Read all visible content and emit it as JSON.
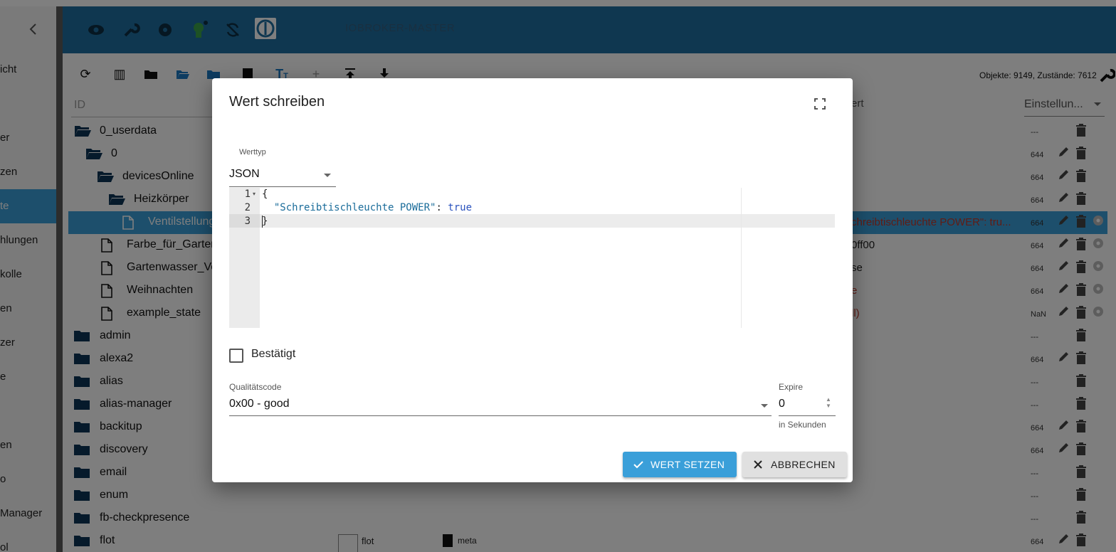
{
  "sidebar": {
    "collapse_icon": "chevron-left-icon",
    "items": [
      {
        "label": "icht",
        "active": false
      },
      {
        "label": "er",
        "active": false
      },
      {
        "label": "zen",
        "active": false
      },
      {
        "label": "te",
        "active": true
      },
      {
        "label": "hlungen",
        "active": false
      },
      {
        "label": "kolle",
        "active": false
      },
      {
        "label": "en",
        "active": false
      },
      {
        "label": "zer",
        "active": false
      },
      {
        "label": "e",
        "active": false
      },
      {
        "label": "en",
        "active": false
      },
      {
        "label": "o",
        "active": false
      },
      {
        "label": "Manager",
        "active": false
      },
      {
        "label": "ol",
        "active": false
      }
    ]
  },
  "header": {
    "icons": [
      "eye-icon",
      "wrench-icon",
      "settings-icon",
      "person-icon",
      "sync-off-icon",
      "iobroker-logo-icon"
    ],
    "host_name": "IOBROKER-MASTER"
  },
  "toolbar": {
    "icons": [
      "refresh-icon",
      "columns-icon",
      "folder-icon",
      "folder-open-icon",
      "folder-blue-icon",
      "document-icon",
      "text-format-icon",
      "add-icon",
      "upload-icon",
      "download-icon"
    ],
    "stats": "Objekte: 9149, Zustände: 7612",
    "settings_icon": "wrench-icon"
  },
  "table": {
    "col_id": "ID",
    "col_value_partial": "ert",
    "settings_select": "Einstellun...",
    "rows": [
      {
        "label": "0_userdata",
        "icon": "folder-open-icon",
        "perm": "---"
      },
      {
        "label": "0",
        "icon": "folder-open-icon",
        "perm": "644"
      },
      {
        "label": "devicesOnline",
        "icon": "folder-open-icon",
        "perm": "664"
      },
      {
        "label": "Heizkörper",
        "icon": "folder-open-icon",
        "perm": "664"
      },
      {
        "label": "Ventilstellung",
        "icon": "file-icon",
        "perm": "664",
        "value": "chreibtischleuchte POWER\": tru..."
      },
      {
        "label": "Farbe_für_Gartenw",
        "icon": "file-icon",
        "perm": "664",
        "value": "0ff00"
      },
      {
        "label": "Gartenwasser_Ven",
        "icon": "file-icon",
        "perm": "664",
        "value": "se"
      },
      {
        "label": "Weihnachten",
        "icon": "file-icon",
        "perm": "664",
        "value": "e"
      },
      {
        "label": "example_state",
        "icon": "file-icon",
        "perm": "NaN",
        "value": "ll)"
      },
      {
        "label": "admin",
        "icon": "folder-icon",
        "perm": "---"
      },
      {
        "label": "alexa2",
        "icon": "folder-icon",
        "perm": "664"
      },
      {
        "label": "alias",
        "icon": "folder-icon",
        "perm": "---"
      },
      {
        "label": "alias-manager",
        "icon": "folder-icon",
        "perm": "---"
      },
      {
        "label": "backitup",
        "icon": "folder-icon",
        "perm": "664"
      },
      {
        "label": "discovery",
        "icon": "folder-icon",
        "perm": "664"
      },
      {
        "label": "email",
        "icon": "folder-icon",
        "perm": "---"
      },
      {
        "label": "enum",
        "icon": "folder-icon",
        "perm": "---"
      },
      {
        "label": "fb-checkpresence",
        "icon": "folder-icon",
        "perm": "---"
      },
      {
        "label": "flot",
        "icon": "folder-icon",
        "perm": "664",
        "name": "flot",
        "role": "meta"
      }
    ]
  },
  "dialog": {
    "title": "Wert schreiben",
    "fullscreen_icon": "fullscreen-icon",
    "value_type_label": "Werttyp",
    "value_type": "JSON",
    "editor_lines": [
      {
        "num": "1",
        "code": "{"
      },
      {
        "num": "2",
        "key": "\"Schreibtischleuchte POWER\"",
        "sep": ": ",
        "bool": "true"
      },
      {
        "num": "3",
        "code": "}"
      }
    ],
    "confirmed_label": "Bestätigt",
    "confirmed": false,
    "quality_label": "Qualitätscode",
    "quality_value": "0x00 - good",
    "expire_label": "Expire",
    "expire_value": "0",
    "expire_helper": "in Sekunden",
    "set_button": "WERT SETZEN",
    "cancel_button": "ABBRECHEN",
    "accent_color": "#3a9fd9"
  }
}
